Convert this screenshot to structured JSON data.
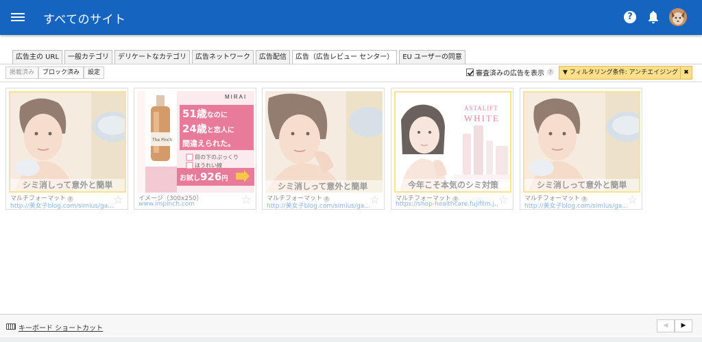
{
  "header": {
    "title": "すべてのサイト"
  },
  "tabs": [
    {
      "label": "広告主の URL",
      "active": false
    },
    {
      "label": "一般カテゴリ",
      "active": false
    },
    {
      "label": "デリケートなカテゴリ",
      "active": false
    },
    {
      "label": "広告ネットワーク",
      "active": false
    },
    {
      "label": "広告配信",
      "active": false
    },
    {
      "label": "広告（広告レビュー センター）",
      "active": true
    },
    {
      "label": "EU ユーザーの同意",
      "active": false
    }
  ],
  "subtabs": {
    "published": "掲載済み",
    "blocked": "ブロック済み",
    "settings": "設定"
  },
  "toolbar": {
    "review_label": "審査済みの広告を表示",
    "help": "?",
    "filter_label": "▼ フィルタリング条件: アンチエイジング",
    "filter_close": "✖"
  },
  "ads": [
    {
      "format": "マルチフォーマット",
      "url": "http://美女子blog.com/simius/ga...",
      "caption": "シミ消しって意外と簡単"
    },
    {
      "format": "イメージ（300x250）",
      "url": "www.impinch.com",
      "caption": "",
      "banner": {
        "brand": "MIRAI",
        "line1": "51歳",
        "line1b": "なのに",
        "line2": "24歳",
        "line2b": "と恋人に",
        "line3": "間違えられた。",
        "check1": "目の下のぷっくり",
        "check2": "ほうれい線",
        "price_prefix": "お試し",
        "price": "926",
        "price_suffix": "円",
        "bottle_label": "The Pinch"
      }
    },
    {
      "format": "マルチフォーマット",
      "url": "http://美女子blog.com/simius/ga...",
      "caption": "シミ消しって意外と簡単"
    },
    {
      "format": "マルチフォーマット",
      "url": "https://shop-healthcare.fujifilm.j...",
      "caption": "今年こそ本気のシミ対策",
      "brand1": "ASTALIFT",
      "brand2": "WHITE"
    },
    {
      "format": "マルチフォーマット",
      "url": "http://美女子blog.com/simius/ga...",
      "caption": "シミ消しって意外と簡単"
    }
  ],
  "footer": {
    "shortcuts": "キーボード ショートカット",
    "prev": "◀",
    "next": "▶"
  },
  "colors": {
    "header": "#1565c0",
    "filter": "#ffe08a",
    "link": "#8ab4e0"
  }
}
